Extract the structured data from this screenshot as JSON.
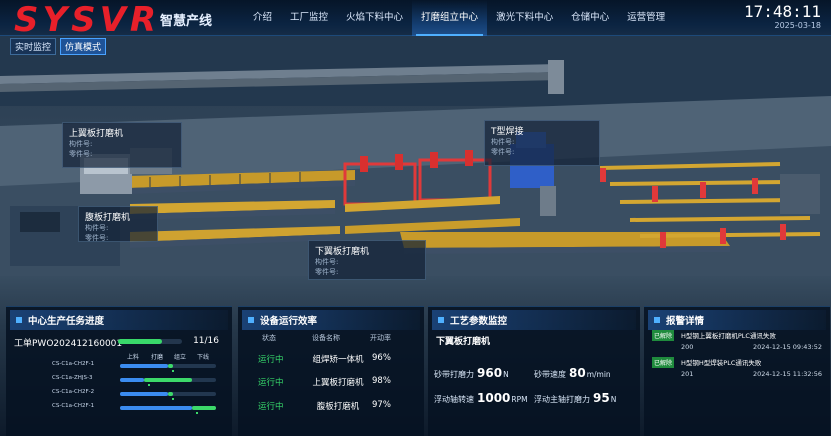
{
  "header": {
    "logo": "SYSVR",
    "subtitle": "智慧产线",
    "nav": [
      "介绍",
      "工厂监控",
      "火焰下料中心",
      "打磨组立中心",
      "激光下料中心",
      "仓储中心",
      "运营管理"
    ],
    "active_nav": 3,
    "time": "17:48:11",
    "date": "2025-03-18"
  },
  "modes": [
    {
      "label": "实时监控",
      "active": false
    },
    {
      "label": "仿真模式",
      "active": true
    }
  ],
  "callouts": [
    {
      "title": "上翼板打磨机",
      "line1": "构件号:",
      "line2": "零件号:"
    },
    {
      "title": "T型焊接",
      "line1": "构件号:",
      "line2": "零件号:"
    },
    {
      "title": "腹板打磨机",
      "line1": "构件号:",
      "line2": "零件号:"
    },
    {
      "title": "下翼板打磨机",
      "line1": "构件号:",
      "line2": "零件号:"
    }
  ],
  "task_panel": {
    "title": "中心生产任务进度",
    "work_order": "工单PWO202412160001",
    "progress": 0.6875,
    "count": "11/16",
    "stages": [
      "上料",
      "打磨",
      "组立",
      "下线"
    ],
    "parts": [
      {
        "id": "CS-C1a-CH2F-1",
        "blue": 0.5,
        "green_start": 0.5,
        "green_end": 0.55
      },
      {
        "id": "CS-C1a-ZHJS-3",
        "blue": 0.25,
        "green_start": 0.25,
        "green_end": 0.75
      },
      {
        "id": "CS-C1a-CH2F-2",
        "blue": 0.5,
        "green_start": 0.5,
        "green_end": 0.55
      },
      {
        "id": "CS-C1a-CH2F-1",
        "blue": 0.75,
        "green_start": 0.75,
        "green_end": 1.0
      }
    ]
  },
  "efficiency_panel": {
    "title": "设备运行效率",
    "headers": [
      "状态",
      "设备名称",
      "开动率"
    ],
    "rows": [
      {
        "state": "运行中",
        "name": "组焊矫一体机",
        "rate": "96%"
      },
      {
        "state": "运行中",
        "name": "上翼板打磨机",
        "rate": "98%"
      },
      {
        "state": "运行中",
        "name": "腹板打磨机",
        "rate": "97%"
      }
    ]
  },
  "process_panel": {
    "title": "工艺参数监控",
    "subtitle": "下翼板打磨机",
    "params": [
      {
        "label": "砂带打磨力",
        "value": "960",
        "unit": "N"
      },
      {
        "label": "砂带速度",
        "value": "80",
        "unit": "m/min"
      },
      {
        "label": "浮动轴转速",
        "value": "1000",
        "unit": "RPM"
      },
      {
        "label": "浮动主轴打磨力",
        "value": "95",
        "unit": "N"
      }
    ]
  },
  "alarm_panel": {
    "title": "报警详情",
    "items": [
      {
        "badge": "已解除",
        "message": "H型钢上翼板打磨机PLC通讯失败",
        "code": "200",
        "time": "2024-12-15 09:43:52"
      },
      {
        "badge": "已解除",
        "message": "H型钢H型焊装PLC通讯失败",
        "code": "201",
        "time": "2024-12-15 11:32:56"
      }
    ]
  },
  "colors": {
    "accent": "#4fb0ff",
    "running": "#36d66a",
    "logo": "#e8202a"
  }
}
